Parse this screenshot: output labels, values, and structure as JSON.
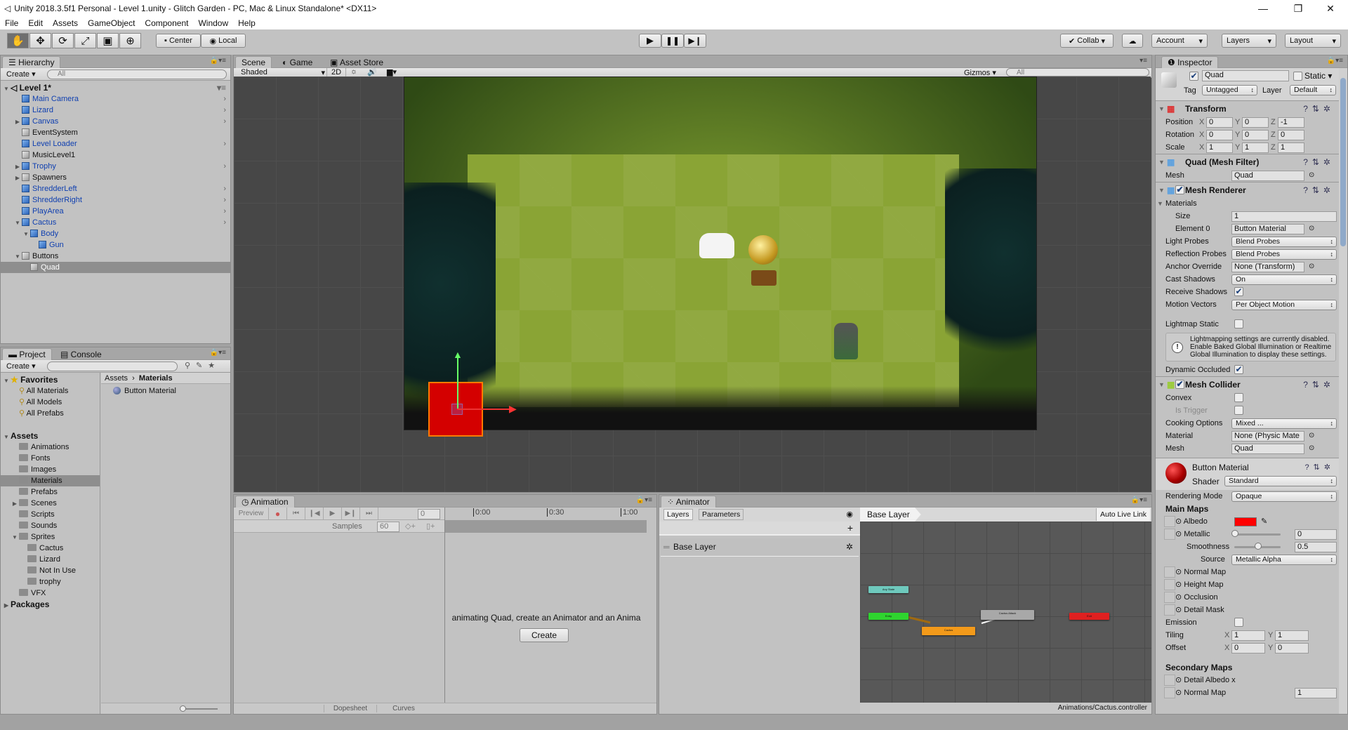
{
  "window": {
    "title": "Unity 2018.3.5f1 Personal - Level 1.unity - Glitch Garden - PC, Mac & Linux Standalone* <DX11>",
    "controls": [
      "—",
      "❐",
      "✕"
    ]
  },
  "menu": [
    "File",
    "Edit",
    "Assets",
    "GameObject",
    "Component",
    "Window",
    "Help"
  ],
  "toolbar": {
    "tools": [
      "hand-tool",
      "move-tool",
      "rotate-tool",
      "scale-tool",
      "rect-tool",
      "transform-tool"
    ],
    "pivot": "Center",
    "space": "Local",
    "collab": "Collab",
    "account": "Account",
    "layers": "Layers",
    "layout": "Layout"
  },
  "hierarchy": {
    "tab": "Hierarchy",
    "create": "Create",
    "search_placeholder": "All",
    "scene": "Level 1*",
    "items": [
      {
        "label": "Main Camera",
        "depth": 1,
        "prefab": true,
        "arrow": "",
        "chev": true
      },
      {
        "label": "Lizard",
        "depth": 1,
        "prefab": true,
        "arrow": "",
        "chev": true
      },
      {
        "label": "Canvas",
        "depth": 1,
        "prefab": true,
        "arrow": "▶",
        "chev": true
      },
      {
        "label": "EventSystem",
        "depth": 1,
        "prefab": false,
        "arrow": "",
        "chev": false
      },
      {
        "label": "Level Loader",
        "depth": 1,
        "prefab": true,
        "arrow": "",
        "chev": true
      },
      {
        "label": "MusicLevel1",
        "depth": 1,
        "prefab": false,
        "arrow": "",
        "chev": false
      },
      {
        "label": "Trophy",
        "depth": 1,
        "prefab": true,
        "arrow": "▶",
        "chev": true
      },
      {
        "label": "Spawners",
        "depth": 1,
        "prefab": false,
        "arrow": "▶",
        "chev": false
      },
      {
        "label": "ShredderLeft",
        "depth": 1,
        "prefab": true,
        "arrow": "",
        "chev": true
      },
      {
        "label": "ShredderRight",
        "depth": 1,
        "prefab": true,
        "arrow": "",
        "chev": true
      },
      {
        "label": "PlayArea",
        "depth": 1,
        "prefab": true,
        "arrow": "",
        "chev": true
      },
      {
        "label": "Cactus",
        "depth": 1,
        "prefab": true,
        "arrow": "▼",
        "chev": true
      },
      {
        "label": "Body",
        "depth": 2,
        "prefab": true,
        "arrow": "▼",
        "chev": false
      },
      {
        "label": "Gun",
        "depth": 3,
        "prefab": true,
        "arrow": "",
        "chev": false
      },
      {
        "label": "Buttons",
        "depth": 1,
        "prefab": false,
        "arrow": "▼",
        "chev": false
      },
      {
        "label": "Quad",
        "depth": 2,
        "prefab": false,
        "arrow": "",
        "chev": false,
        "selected": true
      }
    ]
  },
  "scene": {
    "tabs": [
      "Scene",
      "Game",
      "Asset Store"
    ],
    "shading": "Shaded",
    "mode2d": "2D",
    "gizmos": "Gizmos",
    "search_placeholder": "All"
  },
  "project": {
    "tabs": [
      "Project",
      "Console"
    ],
    "create": "Create",
    "breadcrumb": [
      "Assets",
      "Materials"
    ],
    "assets": [
      "Button Material"
    ],
    "tree": [
      {
        "label": "Favorites",
        "depth": 0,
        "arrow": "▼",
        "bold": true,
        "icon": "star"
      },
      {
        "label": "All Materials",
        "depth": 1,
        "icon": "search"
      },
      {
        "label": "All Models",
        "depth": 1,
        "icon": "search"
      },
      {
        "label": "All Prefabs",
        "depth": 1,
        "icon": "search"
      },
      {
        "label": "",
        "depth": 0,
        "icon": "none"
      },
      {
        "label": "Assets",
        "depth": 0,
        "arrow": "▼",
        "bold": true,
        "icon": "none"
      },
      {
        "label": "Animations",
        "depth": 1,
        "icon": "folder"
      },
      {
        "label": "Fonts",
        "depth": 1,
        "icon": "folder"
      },
      {
        "label": "Images",
        "depth": 1,
        "icon": "folder"
      },
      {
        "label": "Materials",
        "depth": 1,
        "icon": "folder",
        "selected": true
      },
      {
        "label": "Prefabs",
        "depth": 1,
        "icon": "folder"
      },
      {
        "label": "Scenes",
        "depth": 1,
        "icon": "folder",
        "arrow": "▶"
      },
      {
        "label": "Scripts",
        "depth": 1,
        "icon": "folder"
      },
      {
        "label": "Sounds",
        "depth": 1,
        "icon": "folder"
      },
      {
        "label": "Sprites",
        "depth": 1,
        "icon": "folder",
        "arrow": "▼"
      },
      {
        "label": "Cactus",
        "depth": 2,
        "icon": "folder"
      },
      {
        "label": "Lizard",
        "depth": 2,
        "icon": "folder"
      },
      {
        "label": "Not In Use",
        "depth": 2,
        "icon": "folder"
      },
      {
        "label": "trophy",
        "depth": 2,
        "icon": "folder"
      },
      {
        "label": "VFX",
        "depth": 1,
        "icon": "folder"
      },
      {
        "label": "Packages",
        "depth": 0,
        "arrow": "▶",
        "bold": true,
        "icon": "none"
      }
    ]
  },
  "animation": {
    "tab": "Animation",
    "preview": "Preview",
    "frame": "0",
    "samples_label": "Samples",
    "samples": "60",
    "ticks": [
      "0:00",
      "0:30",
      "1:00"
    ],
    "message": "animating Quad, create an Animator and an Anima",
    "create": "Create",
    "bottom_tabs": [
      "Dopesheet",
      "Curves"
    ]
  },
  "animator": {
    "tab": "Animator",
    "tabs": [
      "Layers",
      "Parameters"
    ],
    "layer": "Base Layer",
    "breadcrumb": "Base Layer",
    "auto_live_link": "Auto Live Link",
    "footer": "Animations/Cactus.controller",
    "states": [
      {
        "label": "Any State",
        "color": "#6ec9bd"
      },
      {
        "label": "Entry",
        "color": "#2fd42f"
      },
      {
        "label": "Cactus",
        "color": "#f39a1a"
      },
      {
        "label": "Cactus Attack",
        "color": "#a8a8a8"
      },
      {
        "label": "Exit",
        "color": "#e02020"
      }
    ]
  },
  "inspector": {
    "tab": "Inspector",
    "name": "Quad",
    "static": "Static",
    "tag_label": "Tag",
    "tag": "Untagged",
    "layer_label": "Layer",
    "layer": "Default",
    "transform": {
      "title": "Transform",
      "rows": [
        {
          "label": "Position",
          "x": "0",
          "y": "0",
          "z": "-1"
        },
        {
          "label": "Rotation",
          "x": "0",
          "y": "0",
          "z": "0"
        },
        {
          "label": "Scale",
          "x": "1",
          "y": "1",
          "z": "1"
        }
      ]
    },
    "mesh_filter": {
      "title": "Quad (Mesh Filter)",
      "mesh_label": "Mesh",
      "mesh": "Quad"
    },
    "mesh_renderer": {
      "title": "Mesh Renderer",
      "materials": "Materials",
      "size_label": "Size",
      "size": "1",
      "element_label": "Element 0",
      "element": "Button Material",
      "light_probes_label": "Light Probes",
      "light_probes": "Blend Probes",
      "reflection_label": "Reflection Probes",
      "reflection": "Blend Probes",
      "anchor_label": "Anchor Override",
      "anchor": "None (Transform)",
      "cast_label": "Cast Shadows",
      "cast": "On",
      "receive_label": "Receive Shadows",
      "receive": true,
      "motion_label": "Motion Vectors",
      "motion": "Per Object Motion",
      "lightmap_label": "Lightmap Static",
      "lightmap": false,
      "help": "Lightmapping settings are currently disabled. Enable Baked Global Illumination or Realtime Global Illumination to display these settings.",
      "dynamic_label": "Dynamic Occluded",
      "dynamic": true
    },
    "mesh_collider": {
      "title": "Mesh Collider",
      "convex_label": "Convex",
      "trigger_label": "Is Trigger",
      "cooking_label": "Cooking Options",
      "cooking": "Mixed ...",
      "material_label": "Material",
      "material": "None (Physic Mate",
      "mesh_label": "Mesh",
      "mesh": "Quad"
    },
    "material": {
      "name": "Button Material",
      "shader_label": "Shader",
      "shader": "Standard",
      "rendering_label": "Rendering Mode",
      "rendering": "Opaque",
      "main_maps": "Main Maps",
      "albedo": "Albedo",
      "albedo_color": "#ff0000",
      "metallic": "Metallic",
      "metallic_value": "0",
      "smoothness": "Smoothness",
      "smoothness_value": "0.5",
      "source_label": "Source",
      "source": "Metallic Alpha",
      "normal": "Normal Map",
      "height": "Height Map",
      "occlusion": "Occlusion",
      "detail_mask": "Detail Mask",
      "emission": "Emission",
      "tiling_label": "Tiling",
      "tiling_x": "1",
      "tiling_y": "1",
      "offset_label": "Offset",
      "offset_x": "0",
      "offset_y": "0",
      "secondary": "Secondary Maps",
      "detail_albedo": "Detail Albedo x",
      "normal2": "Normal Map",
      "normal2_value": "1"
    }
  }
}
